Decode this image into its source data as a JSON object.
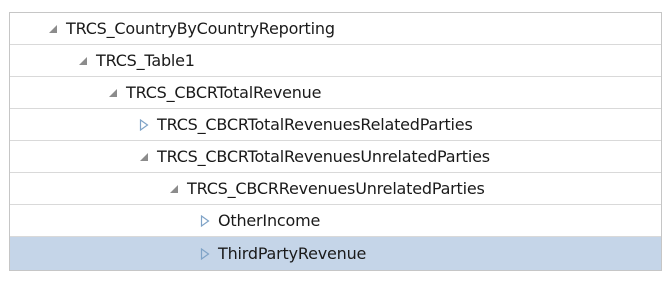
{
  "tree": {
    "nodes": [
      {
        "label": "TRCS_CountryByCountryReporting",
        "state": "expanded",
        "level": 0,
        "selected": false
      },
      {
        "label": "TRCS_Table1",
        "state": "expanded",
        "level": 1,
        "selected": false
      },
      {
        "label": "TRCS_CBCRTotalRevenue",
        "state": "expanded",
        "level": 2,
        "selected": false
      },
      {
        "label": "TRCS_CBCRTotalRevenuesRelatedParties",
        "state": "collapsed",
        "level": 3,
        "selected": false
      },
      {
        "label": "TRCS_CBCRTotalRevenuesUnrelatedParties",
        "state": "expanded",
        "level": 3,
        "selected": false
      },
      {
        "label": "TRCS_CBCRRevenuesUnrelatedParties",
        "state": "expanded",
        "level": 4,
        "selected": false
      },
      {
        "label": "OtherIncome",
        "state": "collapsed",
        "level": 5,
        "selected": false
      },
      {
        "label": "ThirdPartyRevenue",
        "state": "collapsed",
        "level": 5,
        "selected": true
      }
    ]
  },
  "icons": {
    "expanded": "expanded-triangle-icon",
    "collapsed": "collapsed-arrow-icon"
  },
  "colors": {
    "selected_row": "#c5d5e8",
    "expanded_icon": "#8c8c8c",
    "collapsed_icon": "#7fa3c7"
  }
}
